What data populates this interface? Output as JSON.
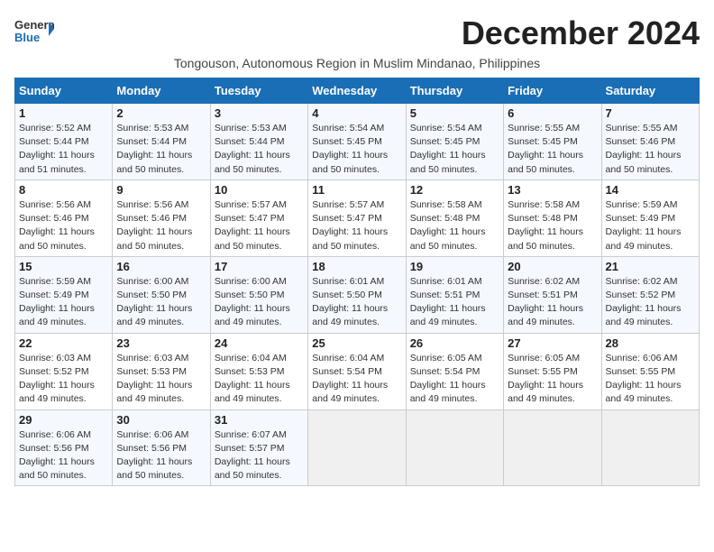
{
  "header": {
    "logo_general": "General",
    "logo_blue": "Blue",
    "month_title": "December 2024",
    "subtitle": "Tongouson, Autonomous Region in Muslim Mindanao, Philippines"
  },
  "days_of_week": [
    "Sunday",
    "Monday",
    "Tuesday",
    "Wednesday",
    "Thursday",
    "Friday",
    "Saturday"
  ],
  "weeks": [
    [
      {
        "day": 1,
        "info": "Sunrise: 5:52 AM\nSunset: 5:44 PM\nDaylight: 11 hours\nand 51 minutes."
      },
      {
        "day": 2,
        "info": "Sunrise: 5:53 AM\nSunset: 5:44 PM\nDaylight: 11 hours\nand 50 minutes."
      },
      {
        "day": 3,
        "info": "Sunrise: 5:53 AM\nSunset: 5:44 PM\nDaylight: 11 hours\nand 50 minutes."
      },
      {
        "day": 4,
        "info": "Sunrise: 5:54 AM\nSunset: 5:45 PM\nDaylight: 11 hours\nand 50 minutes."
      },
      {
        "day": 5,
        "info": "Sunrise: 5:54 AM\nSunset: 5:45 PM\nDaylight: 11 hours\nand 50 minutes."
      },
      {
        "day": 6,
        "info": "Sunrise: 5:55 AM\nSunset: 5:45 PM\nDaylight: 11 hours\nand 50 minutes."
      },
      {
        "day": 7,
        "info": "Sunrise: 5:55 AM\nSunset: 5:46 PM\nDaylight: 11 hours\nand 50 minutes."
      }
    ],
    [
      {
        "day": 8,
        "info": "Sunrise: 5:56 AM\nSunset: 5:46 PM\nDaylight: 11 hours\nand 50 minutes."
      },
      {
        "day": 9,
        "info": "Sunrise: 5:56 AM\nSunset: 5:46 PM\nDaylight: 11 hours\nand 50 minutes."
      },
      {
        "day": 10,
        "info": "Sunrise: 5:57 AM\nSunset: 5:47 PM\nDaylight: 11 hours\nand 50 minutes."
      },
      {
        "day": 11,
        "info": "Sunrise: 5:57 AM\nSunset: 5:47 PM\nDaylight: 11 hours\nand 50 minutes."
      },
      {
        "day": 12,
        "info": "Sunrise: 5:58 AM\nSunset: 5:48 PM\nDaylight: 11 hours\nand 50 minutes."
      },
      {
        "day": 13,
        "info": "Sunrise: 5:58 AM\nSunset: 5:48 PM\nDaylight: 11 hours\nand 50 minutes."
      },
      {
        "day": 14,
        "info": "Sunrise: 5:59 AM\nSunset: 5:49 PM\nDaylight: 11 hours\nand 49 minutes."
      }
    ],
    [
      {
        "day": 15,
        "info": "Sunrise: 5:59 AM\nSunset: 5:49 PM\nDaylight: 11 hours\nand 49 minutes."
      },
      {
        "day": 16,
        "info": "Sunrise: 6:00 AM\nSunset: 5:50 PM\nDaylight: 11 hours\nand 49 minutes."
      },
      {
        "day": 17,
        "info": "Sunrise: 6:00 AM\nSunset: 5:50 PM\nDaylight: 11 hours\nand 49 minutes."
      },
      {
        "day": 18,
        "info": "Sunrise: 6:01 AM\nSunset: 5:50 PM\nDaylight: 11 hours\nand 49 minutes."
      },
      {
        "day": 19,
        "info": "Sunrise: 6:01 AM\nSunset: 5:51 PM\nDaylight: 11 hours\nand 49 minutes."
      },
      {
        "day": 20,
        "info": "Sunrise: 6:02 AM\nSunset: 5:51 PM\nDaylight: 11 hours\nand 49 minutes."
      },
      {
        "day": 21,
        "info": "Sunrise: 6:02 AM\nSunset: 5:52 PM\nDaylight: 11 hours\nand 49 minutes."
      }
    ],
    [
      {
        "day": 22,
        "info": "Sunrise: 6:03 AM\nSunset: 5:52 PM\nDaylight: 11 hours\nand 49 minutes."
      },
      {
        "day": 23,
        "info": "Sunrise: 6:03 AM\nSunset: 5:53 PM\nDaylight: 11 hours\nand 49 minutes."
      },
      {
        "day": 24,
        "info": "Sunrise: 6:04 AM\nSunset: 5:53 PM\nDaylight: 11 hours\nand 49 minutes."
      },
      {
        "day": 25,
        "info": "Sunrise: 6:04 AM\nSunset: 5:54 PM\nDaylight: 11 hours\nand 49 minutes."
      },
      {
        "day": 26,
        "info": "Sunrise: 6:05 AM\nSunset: 5:54 PM\nDaylight: 11 hours\nand 49 minutes."
      },
      {
        "day": 27,
        "info": "Sunrise: 6:05 AM\nSunset: 5:55 PM\nDaylight: 11 hours\nand 49 minutes."
      },
      {
        "day": 28,
        "info": "Sunrise: 6:06 AM\nSunset: 5:55 PM\nDaylight: 11 hours\nand 49 minutes."
      }
    ],
    [
      {
        "day": 29,
        "info": "Sunrise: 6:06 AM\nSunset: 5:56 PM\nDaylight: 11 hours\nand 50 minutes."
      },
      {
        "day": 30,
        "info": "Sunrise: 6:06 AM\nSunset: 5:56 PM\nDaylight: 11 hours\nand 50 minutes."
      },
      {
        "day": 31,
        "info": "Sunrise: 6:07 AM\nSunset: 5:57 PM\nDaylight: 11 hours\nand 50 minutes."
      },
      null,
      null,
      null,
      null
    ]
  ]
}
